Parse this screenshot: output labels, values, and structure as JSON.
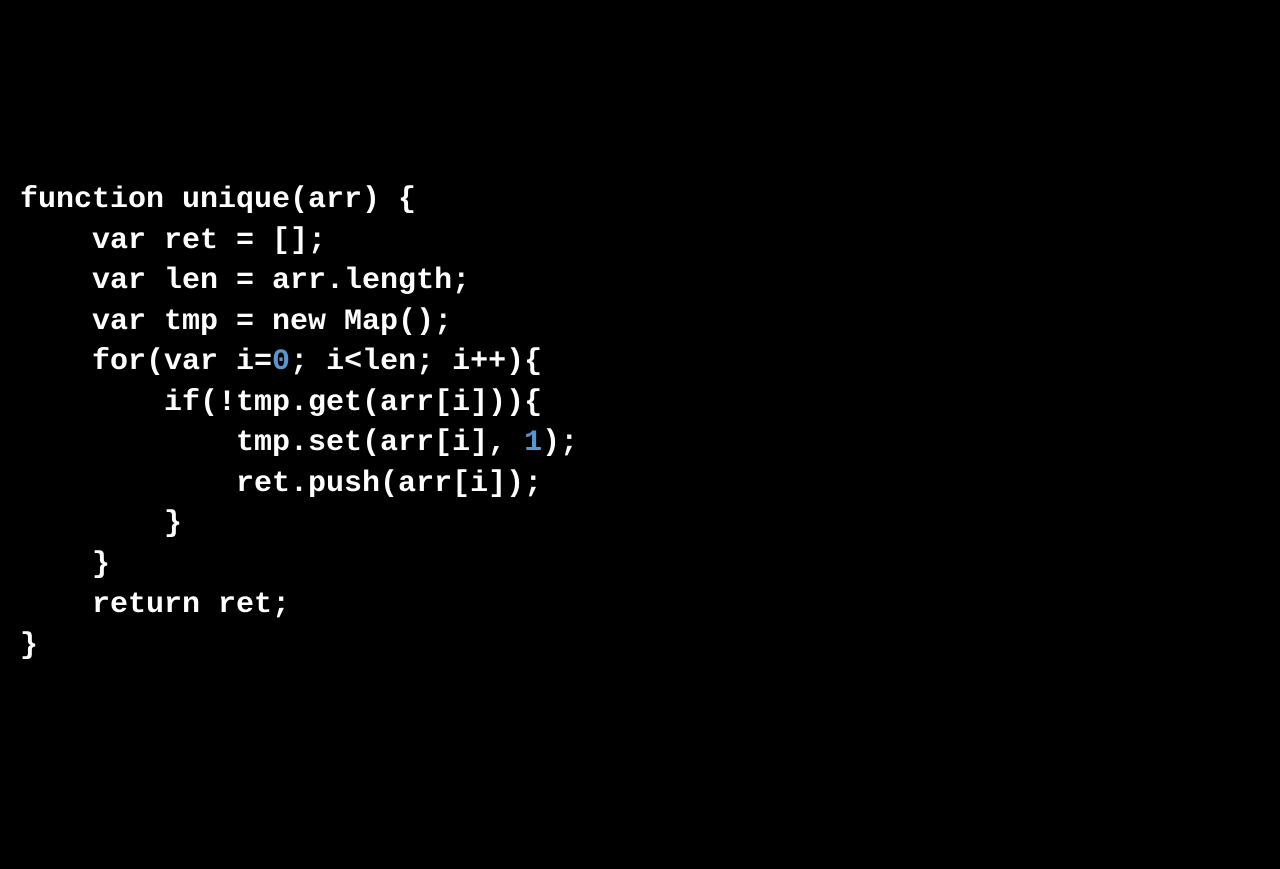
{
  "code": {
    "line1_a": "function unique(arr) {",
    "line2_a": "    var ret = [];",
    "line3_a": "    var len = arr.length;",
    "line4_a": "    var tmp = new Map();",
    "line5_a": "    for(var i=",
    "line5_num": "0",
    "line5_b": "; i<len; i++){",
    "line6_a": "        if(!tmp.get(arr[i])){",
    "line7_a": "            tmp.set(arr[i], ",
    "line7_num": "1",
    "line7_b": ");",
    "line8_a": "            ret.push(arr[i]);",
    "line9_a": "        }",
    "line10_a": "    }",
    "line11_a": "    return ret;",
    "line12_a": "}"
  }
}
